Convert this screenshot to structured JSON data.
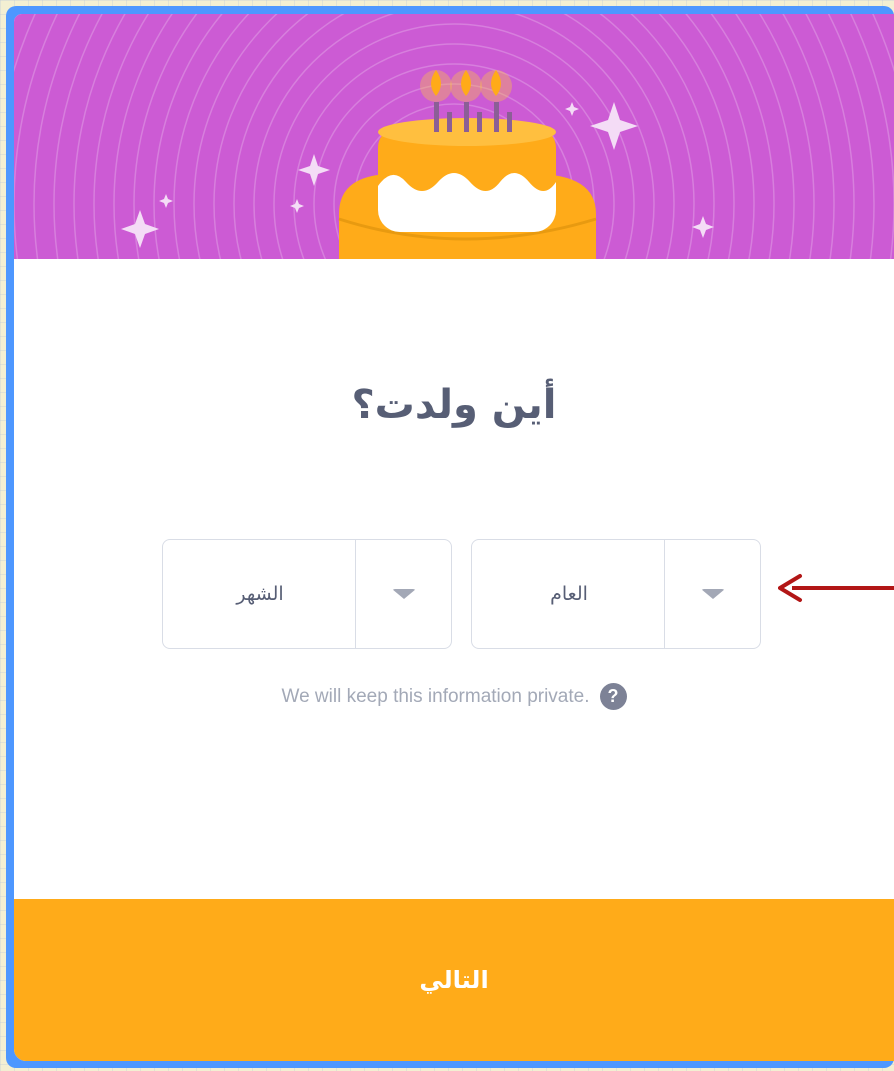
{
  "dialog": {
    "title": "أين ولدت؟",
    "month_select": {
      "value": "الشهر"
    },
    "year_select": {
      "value": "العام"
    },
    "privacy_note": "We will keep this information private.",
    "help_symbol": "?",
    "next_button_label": "التالي"
  },
  "icons": {
    "banner": "birthday-cake-illustration",
    "dropdown": "caret-down-icon",
    "help": "question-mark-circle-icon",
    "annotation": "red-arrow-left"
  },
  "colors": {
    "frame": "#4d97ff",
    "banner": "#cc5bd4",
    "cake": "#ffab19",
    "footer": "#ffab19",
    "title_text": "#575e75",
    "annotation_arrow": "#b21616"
  }
}
